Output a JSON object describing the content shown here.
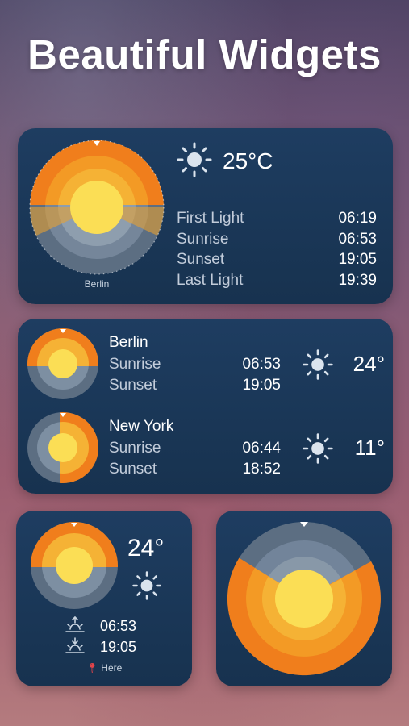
{
  "headline": "Beautiful Widgets",
  "colors": {
    "card": "#1b3858",
    "day_orange": "#f07e1c",
    "sun_yellow": "#fbde55",
    "twilight": "#f5b235",
    "night_grey": "#5d7084"
  },
  "widget_large": {
    "city": "Berlin",
    "weather_icon": "sun-icon",
    "temperature": "25°C",
    "rows": [
      {
        "label": "First Light",
        "time": "06:19"
      },
      {
        "label": "Sunrise",
        "time": "06:53"
      },
      {
        "label": "Sunset",
        "time": "19:05"
      },
      {
        "label": "Last Light",
        "time": "19:39"
      }
    ]
  },
  "widget_medium": {
    "cities": [
      {
        "name": "Berlin",
        "sunrise_label": "Sunrise",
        "sunrise": "06:53",
        "sunset_label": "Sunset",
        "sunset": "19:05",
        "weather_icon": "sun-icon",
        "temperature": "24°"
      },
      {
        "name": "New York",
        "sunrise_label": "Sunrise",
        "sunrise": "06:44",
        "sunset_label": "Sunset",
        "sunset": "18:52",
        "weather_icon": "sun-icon",
        "temperature": "11°"
      }
    ]
  },
  "widget_small": {
    "temperature": "24°",
    "weather_icon": "sun-icon",
    "sunrise": "06:53",
    "sunset": "19:05",
    "location": "Here",
    "location_icon": "pin-icon"
  },
  "widget_dial": {
    "dial_icon": "daylight-dial-icon"
  }
}
